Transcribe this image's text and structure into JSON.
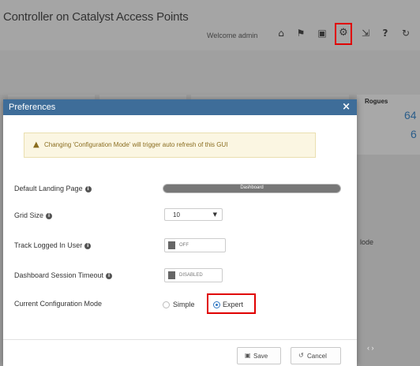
{
  "app": {
    "title": "Controller on Catalyst Access Points",
    "welcome": "Welcome admin",
    "toolbar_icons": [
      "home-icon",
      "bookmark-icon",
      "save-icon",
      "gear-icon",
      "download-icon",
      "help-icon",
      "refresh-icon"
    ],
    "toolbar_glyphs": [
      "⌂",
      "⚑",
      "▣",
      "⚙",
      "⇲",
      "?",
      "↻"
    ],
    "highlight_color": "#e00000"
  },
  "background": {
    "rogues_label": "Rogues",
    "rogue_counts": [
      "64",
      "6"
    ],
    "mode_text": "lode",
    "arrows": "‹ ›"
  },
  "modal": {
    "title": "Preferences",
    "close_glyph": "×",
    "alert": {
      "icon": "warning-icon",
      "glyph": "▲",
      "text": "Changing 'Configuration Mode' will trigger auto refresh of this GUI"
    },
    "rows": {
      "landing_label": "Default Landing Page",
      "landing_value": "Dashboard",
      "grid_label": "Grid Size",
      "grid_value": "10",
      "track_label": "Track Logged In User",
      "track_value": "OFF",
      "timeout_label": "Dashboard Session Timeout",
      "timeout_value": "DISABLED",
      "mode_label": "Current Configuration Mode",
      "mode_simple": "Simple",
      "mode_expert": "Expert"
    },
    "buttons": {
      "save_label": "Save",
      "cancel_label": "Cancel"
    },
    "header_color": "#3e6d99",
    "radio_color": "#2f76c2"
  }
}
